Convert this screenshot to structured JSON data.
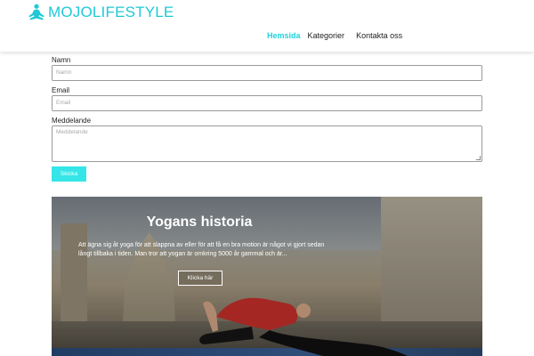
{
  "header": {
    "logo_text": "MOJOLIFESTYLE",
    "logo_icon": "yoga-pose-icon",
    "nav": [
      {
        "label": "Hemsida",
        "active": true
      },
      {
        "label": "Kategorier",
        "active": false
      },
      {
        "label": "Kontakta oss",
        "active": false
      }
    ]
  },
  "form": {
    "name_label": "Namn",
    "name_placeholder": "Namn",
    "email_label": "Email",
    "email_placeholder": "Email",
    "message_label": "Meddelande",
    "message_placeholder": "Meddelande",
    "submit_label": "Skicka"
  },
  "hero": {
    "title": "Yogans historia",
    "text": "Att ägna sig åt yoga för att slappna av eller för att få en bra motion är något vi gjort sedan långt tillbaka i tiden. Man tror att yogan är omkring 5000 år gammal och är...",
    "button_label": "Klicka här"
  },
  "colors": {
    "accent": "#1fd3dd",
    "button": "#35e5e8"
  }
}
